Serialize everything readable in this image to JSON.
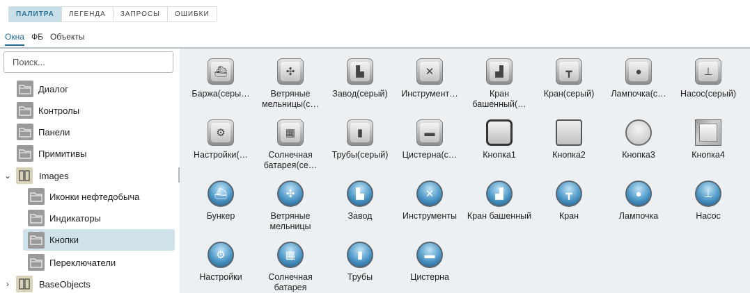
{
  "top_tabs": [
    "ПАЛИТРА",
    "ЛЕГЕНДА",
    "ЗАПРОСЫ",
    "ОШИБКИ"
  ],
  "sub_tabs": [
    "Окна",
    "ФБ",
    "Объекты"
  ],
  "search": {
    "placeholder": "Поиск..."
  },
  "tree": {
    "dialog": "Диалог",
    "controls": "Контролы",
    "panels": "Панели",
    "primitives": "Примитивы",
    "images": "Images",
    "oil_icons": "Иконки нефтедобыча",
    "indicators": "Индикаторы",
    "buttons": "Кнопки",
    "switches": "Переключатели",
    "base_objects": "BaseObjects",
    "expand_glyph": "⌄",
    "collapse_glyph": "›"
  },
  "grid": [
    {
      "label": "Баржа(серы…",
      "style": "gray",
      "glyph": "⛴"
    },
    {
      "label": "Ветряные мельницы(с…",
      "style": "gray",
      "glyph": "✣"
    },
    {
      "label": "Завод(серый)",
      "style": "gray",
      "glyph": "▙"
    },
    {
      "label": "Инструмент…",
      "style": "gray",
      "glyph": "✕"
    },
    {
      "label": "Кран башенный(…",
      "style": "gray",
      "glyph": "▟"
    },
    {
      "label": "Кран(серый)",
      "style": "gray",
      "glyph": "┳"
    },
    {
      "label": "Лампочка(с…",
      "style": "gray",
      "glyph": "●"
    },
    {
      "label": "Насос(серый)",
      "style": "gray",
      "glyph": "⊥"
    },
    {
      "label": "Настройки(…",
      "style": "gray",
      "glyph": "⚙"
    },
    {
      "label": "Солнечная батарея(се…",
      "style": "gray",
      "glyph": "▦"
    },
    {
      "label": "Трубы(серый)",
      "style": "gray",
      "glyph": "▮"
    },
    {
      "label": "Цистерна(с…",
      "style": "gray",
      "glyph": "▬"
    },
    {
      "label": "Кнопка1",
      "style": "btn1",
      "glyph": ""
    },
    {
      "label": "Кнопка2",
      "style": "btn2",
      "glyph": ""
    },
    {
      "label": "Кнопка3",
      "style": "btn3",
      "glyph": ""
    },
    {
      "label": "Кнопка4",
      "style": "btn4",
      "glyph": ""
    },
    {
      "label": "Бункер",
      "style": "blue",
      "glyph": "⛴"
    },
    {
      "label": "Ветряные мельницы",
      "style": "blue",
      "glyph": "✣"
    },
    {
      "label": "Завод",
      "style": "blue",
      "glyph": "▙"
    },
    {
      "label": "Инструменты",
      "style": "blue",
      "glyph": "✕"
    },
    {
      "label": "Кран башенный",
      "style": "blue",
      "glyph": "▟"
    },
    {
      "label": "Кран",
      "style": "blue",
      "glyph": "┳"
    },
    {
      "label": "Лампочка",
      "style": "blue",
      "glyph": "●"
    },
    {
      "label": "Насос",
      "style": "blue",
      "glyph": "⊥"
    },
    {
      "label": "Настройки",
      "style": "blue",
      "glyph": "⚙"
    },
    {
      "label": "Солнечная батарея",
      "style": "blue",
      "glyph": "▦"
    },
    {
      "label": "Трубы",
      "style": "blue",
      "glyph": "▮"
    },
    {
      "label": "Цистерна",
      "style": "blue",
      "glyph": "▬"
    }
  ],
  "colors": {
    "accent": "#1e6a94",
    "selected_bg": "#cfe2ea",
    "panel_bg": "#edf0f2"
  }
}
